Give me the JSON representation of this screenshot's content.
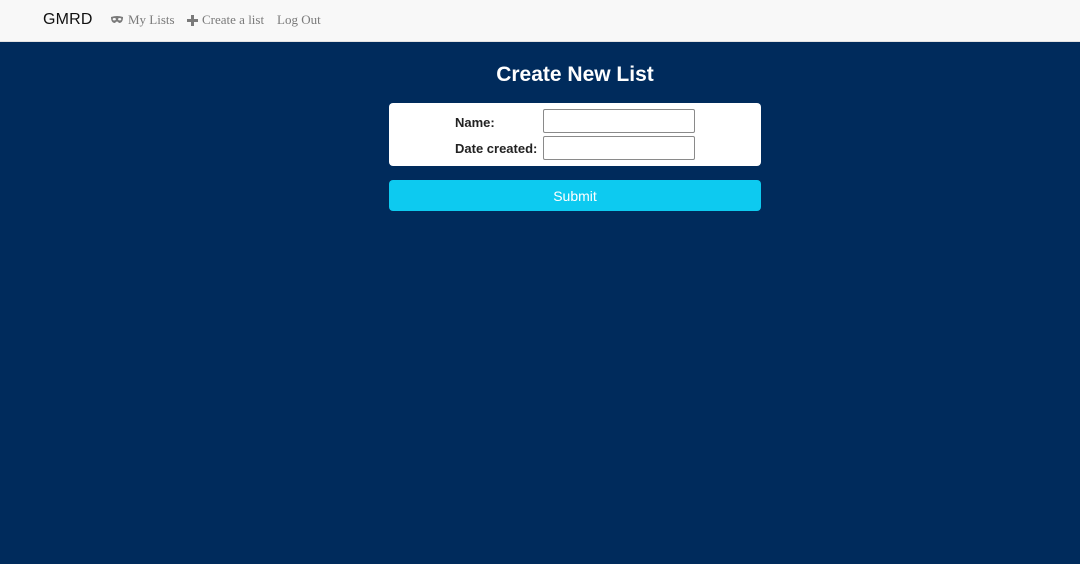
{
  "navbar": {
    "brand": "GMRD",
    "items": [
      {
        "label": "My Lists",
        "icon": "mask-icon"
      },
      {
        "label": "Create a list",
        "icon": "plus-icon"
      },
      {
        "label": "Log Out"
      }
    ]
  },
  "main": {
    "title": "Create New List",
    "form": {
      "name_label": "Name:",
      "name_value": "",
      "date_label": "Date created:",
      "date_value": ""
    },
    "submit_label": "Submit"
  },
  "colors": {
    "background": "#002b5c",
    "navbar": "#f8f8f8",
    "submit": "#0dcaf0"
  }
}
